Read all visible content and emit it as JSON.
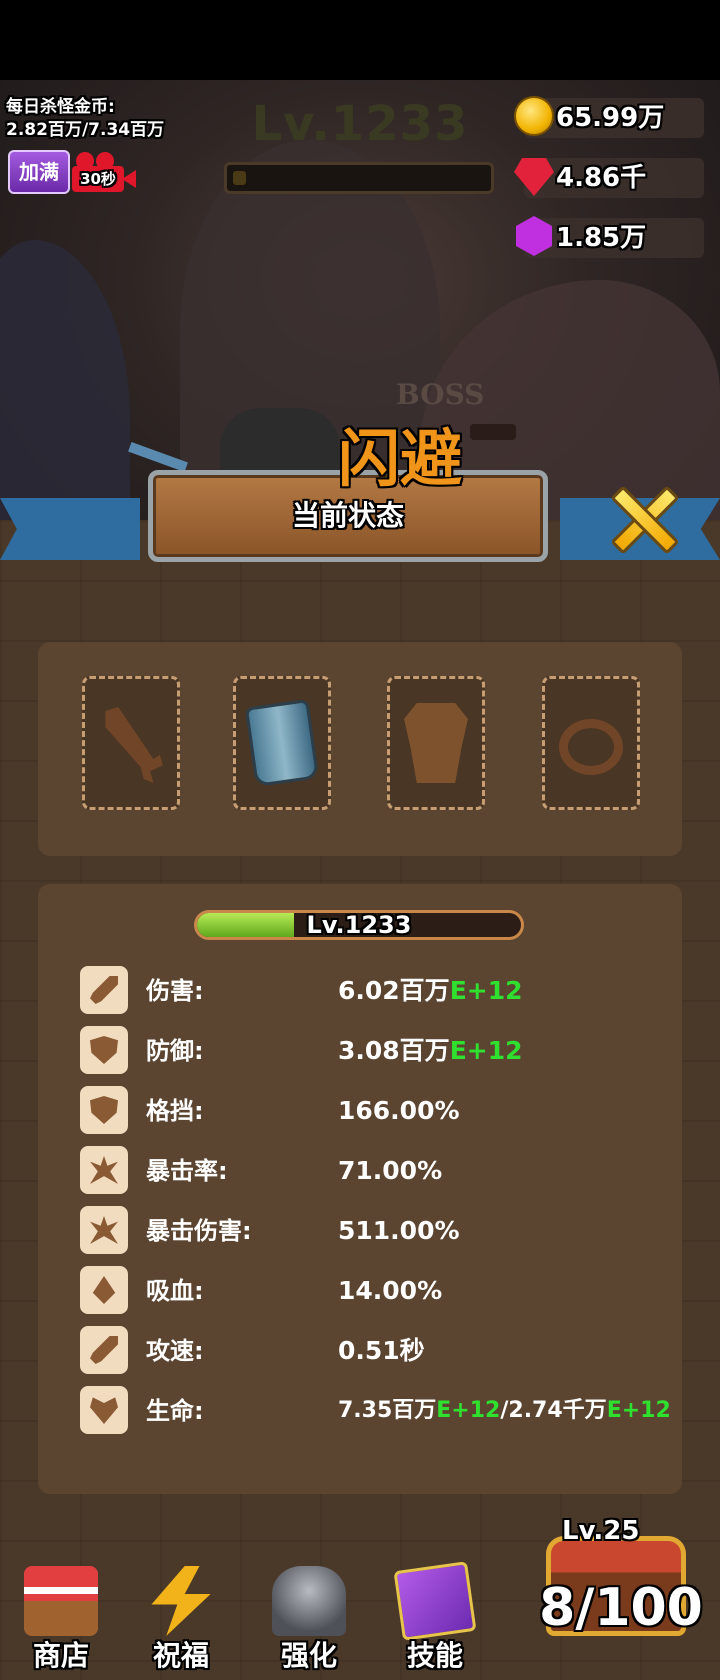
{
  "header": {
    "daily_label": "每日杀怪金币:",
    "daily_value": "2.82百万/7.34百万",
    "fill_button": "加满",
    "video_timer": "30秒",
    "level": "Lv.1233",
    "level_progress": 0.05
  },
  "currency": {
    "coins": "65.99万",
    "rubies": "4.86千",
    "gems": "1.85万"
  },
  "battle": {
    "boss_label": "BOSS",
    "popup_text": "闪避"
  },
  "panel": {
    "title": "当前状态"
  },
  "equipment": [
    {
      "slot": "weapon",
      "equipped": false
    },
    {
      "slot": "bracer",
      "equipped": true
    },
    {
      "slot": "armor",
      "equipped": false
    },
    {
      "slot": "ring",
      "equipped": false
    }
  ],
  "stats": {
    "level": "Lv.1233",
    "level_progress": 0.3,
    "rows": [
      {
        "label": "伤害:",
        "value": "6.02百万",
        "exp": "E+12",
        "icon": "sword-icon"
      },
      {
        "label": "防御:",
        "value": "3.08百万",
        "exp": "E+12",
        "icon": "shield-icon"
      },
      {
        "label": "格挡:",
        "value": "166.00%",
        "icon": "block-shield-icon"
      },
      {
        "label": "暴击率:",
        "value": "71.00%",
        "icon": "crit-icon"
      },
      {
        "label": "暴击伤害:",
        "value": "511.00%",
        "icon": "crit-damage-icon"
      },
      {
        "label": "吸血:",
        "value": "14.00%",
        "icon": "lifesteal-icon"
      },
      {
        "label": "攻速:",
        "value": "0.51秒",
        "icon": "attack-speed-icon"
      },
      {
        "label": "生命:",
        "value": "7.35百万",
        "exp": "E+12",
        "value2": "/2.74千万",
        "exp2": "E+12",
        "icon": "heart-icon"
      }
    ]
  },
  "nav": {
    "shop": "商店",
    "bless": "祝福",
    "upgrade": "强化",
    "skills": "技能"
  },
  "chest": {
    "level": "Lv.25",
    "progress": "8/100"
  },
  "colors": {
    "exp_green": "#2fe02f",
    "popup_orange": "#f0951a",
    "panel_brown": "#5b4531"
  }
}
